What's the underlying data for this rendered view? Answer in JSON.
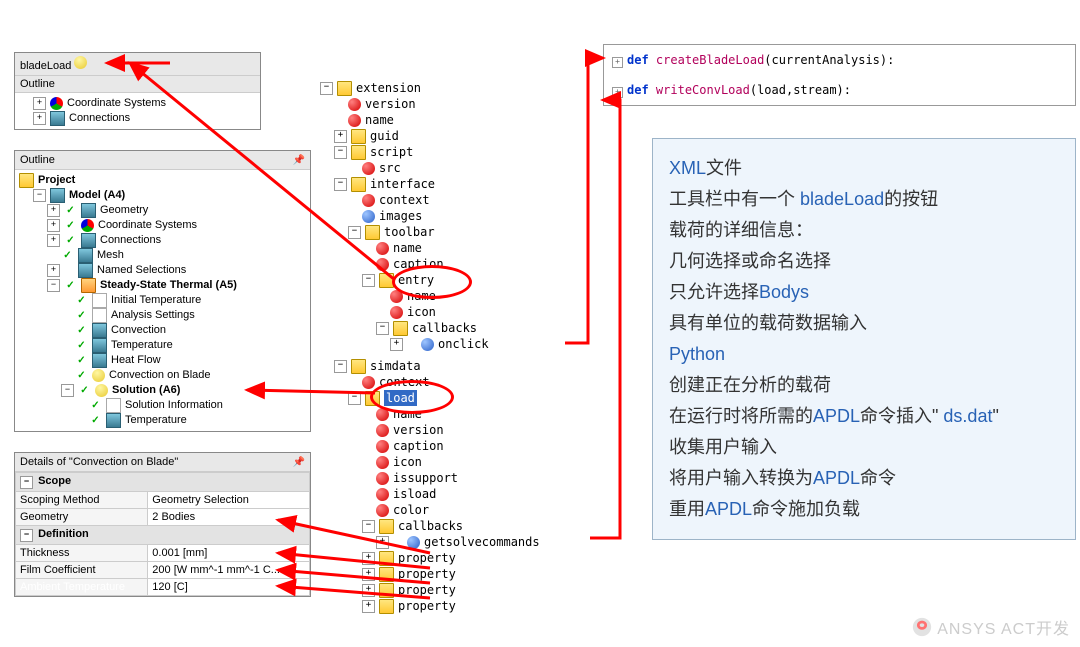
{
  "blade_toolbar": {
    "title": "bladeLoad",
    "outline": "Outline",
    "items": [
      "Coordinate Systems",
      "Connections"
    ]
  },
  "outline": {
    "title": "Outline",
    "project": "Project",
    "model": "Model (A4)",
    "model_children": [
      "Geometry",
      "Coordinate Systems",
      "Connections",
      "Mesh",
      "Named Selections"
    ],
    "sst": "Steady-State Thermal (A5)",
    "sst_children": [
      "Initial Temperature",
      "Analysis Settings",
      "Convection",
      "Temperature",
      "Heat Flow",
      "Convection on Blade"
    ],
    "solution": "Solution (A6)",
    "solution_children": [
      "Solution Information",
      "Temperature"
    ]
  },
  "details": {
    "title": "Details of \"Convection on Blade\"",
    "group1": "Scope",
    "scoping_method": {
      "l": "Scoping Method",
      "v": "Geometry Selection"
    },
    "geometry": {
      "l": "Geometry",
      "v": "2 Bodies"
    },
    "group2": "Definition",
    "thickness": {
      "l": "Thickness",
      "v": "0.001 [mm]"
    },
    "film": {
      "l": "Film Coefficient",
      "v": "200 [W mm^-1 mm^-1 C..."
    },
    "ambient": {
      "l": "Ambient Temperature",
      "v": "120 [C]"
    }
  },
  "xmltree": {
    "root": "extension",
    "version": "version",
    "name": "name",
    "guid": "guid",
    "script": "script",
    "src": "src",
    "interface": "interface",
    "context": "context",
    "images": "images",
    "toolbar": "toolbar",
    "tname": "name",
    "caption": "caption",
    "entry": "entry",
    "ename": "name",
    "icon": "icon",
    "callbacks": "callbacks",
    "onclick": "onclick",
    "simdata": "simdata",
    "scontext": "context",
    "load": "load",
    "sname": "name",
    "sversion": "version",
    "scaption": "caption",
    "sicon": "icon",
    "issupport": "issupport",
    "isload": "isload",
    "color": "color",
    "scallbacks": "callbacks",
    "getsolve": "getsolvecommands",
    "property": "property"
  },
  "code": {
    "def": "def",
    "f1": "createBladeLoad",
    "a1": "(currentAnalysis):",
    "f2": "writeConvLoad",
    "a2": "(load,stream):"
  },
  "explain": {
    "l1a": "XML",
    "l1b": "文件",
    "l2a": "工具栏中有一个 ",
    "l2b": "bladeLoad",
    "l2c": "的按钮",
    "l3": "载荷的详细信息：",
    "l4": "几何选择或命名选择",
    "l5a": "只允许选择",
    "l5b": "Bodys",
    "l6": "具有单位的载荷数据输入",
    "l7": "Python",
    "l8": "创建正在分析的载荷",
    "l9a": "在运行时将所需的",
    "l9b": "APDL",
    "l9c": "命令插入\" ",
    "l9d": "ds.dat",
    "l9e": "\"",
    "l10": "收集用户输入",
    "l11a": "将用户输入转换为",
    "l11b": "APDL",
    "l11c": "命令",
    "l12a": "重用",
    "l12b": "APDL",
    "l12c": "命令施加负载"
  },
  "wm": "ANSYS ACT开发"
}
